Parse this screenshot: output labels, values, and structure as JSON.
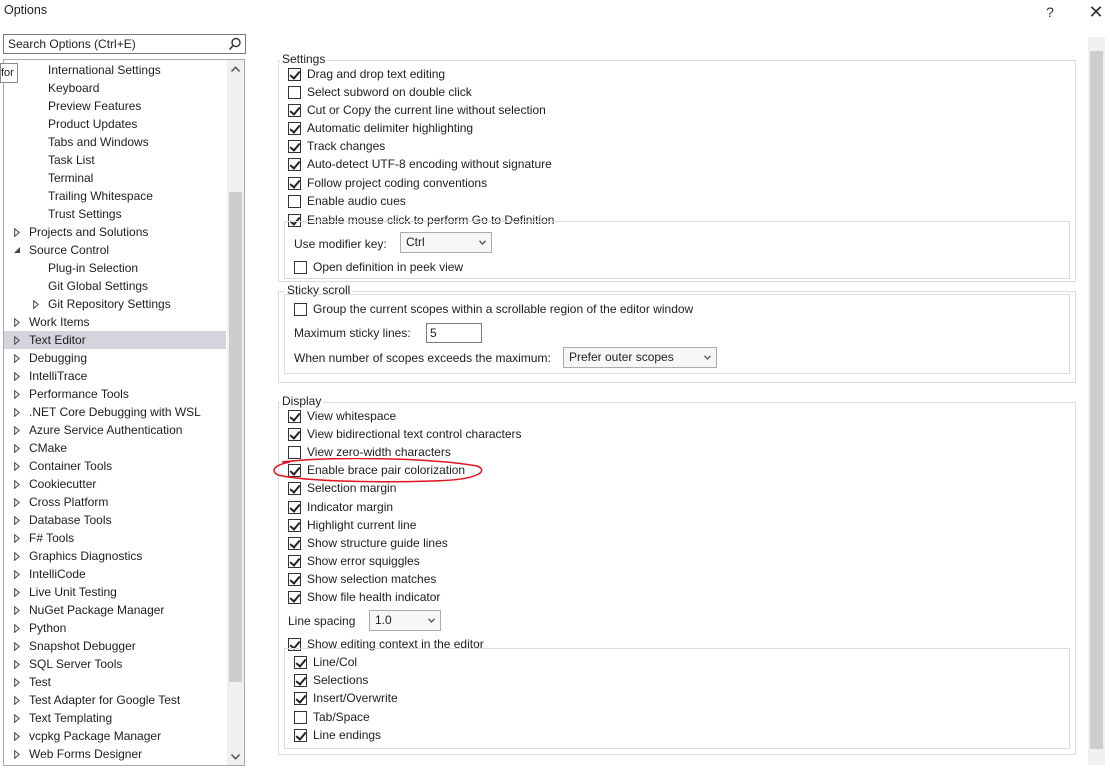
{
  "window": {
    "title": "Options",
    "help_glyph": "?",
    "close_glyph": "✕"
  },
  "search": {
    "placeholder": "Search Options (Ctrl+E)"
  },
  "tooltip_fragment": "for",
  "tree": {
    "items": [
      {
        "label": "International Settings",
        "indent": 2,
        "expander": ""
      },
      {
        "label": "Keyboard",
        "indent": 2,
        "expander": ""
      },
      {
        "label": "Preview Features",
        "indent": 2,
        "expander": ""
      },
      {
        "label": "Product Updates",
        "indent": 2,
        "expander": ""
      },
      {
        "label": "Tabs and Windows",
        "indent": 2,
        "expander": ""
      },
      {
        "label": "Task List",
        "indent": 2,
        "expander": ""
      },
      {
        "label": "Terminal",
        "indent": 2,
        "expander": ""
      },
      {
        "label": "Trailing Whitespace",
        "indent": 2,
        "expander": ""
      },
      {
        "label": "Trust Settings",
        "indent": 2,
        "expander": ""
      },
      {
        "label": "Projects and Solutions",
        "indent": 1,
        "expander": "collapsed"
      },
      {
        "label": "Source Control",
        "indent": 1,
        "expander": "expanded"
      },
      {
        "label": "Plug-in Selection",
        "indent": 2,
        "expander": ""
      },
      {
        "label": "Git Global Settings",
        "indent": 2,
        "expander": ""
      },
      {
        "label": "Git Repository Settings",
        "indent": 2,
        "expander": "collapsed"
      },
      {
        "label": "Work Items",
        "indent": 1,
        "expander": "collapsed"
      },
      {
        "label": "Text Editor",
        "indent": 1,
        "expander": "collapsed",
        "selected": true
      },
      {
        "label": "Debugging",
        "indent": 1,
        "expander": "collapsed"
      },
      {
        "label": "IntelliTrace",
        "indent": 1,
        "expander": "collapsed"
      },
      {
        "label": "Performance Tools",
        "indent": 1,
        "expander": "collapsed"
      },
      {
        "label": ".NET Core Debugging with WSL",
        "indent": 1,
        "expander": "collapsed"
      },
      {
        "label": "Azure Service Authentication",
        "indent": 1,
        "expander": "collapsed"
      },
      {
        "label": "CMake",
        "indent": 1,
        "expander": "collapsed"
      },
      {
        "label": "Container Tools",
        "indent": 1,
        "expander": "collapsed"
      },
      {
        "label": "Cookiecutter",
        "indent": 1,
        "expander": "collapsed"
      },
      {
        "label": "Cross Platform",
        "indent": 1,
        "expander": "collapsed"
      },
      {
        "label": "Database Tools",
        "indent": 1,
        "expander": "collapsed"
      },
      {
        "label": "F# Tools",
        "indent": 1,
        "expander": "collapsed"
      },
      {
        "label": "Graphics Diagnostics",
        "indent": 1,
        "expander": "collapsed"
      },
      {
        "label": "IntelliCode",
        "indent": 1,
        "expander": "collapsed"
      },
      {
        "label": "Live Unit Testing",
        "indent": 1,
        "expander": "collapsed"
      },
      {
        "label": "NuGet Package Manager",
        "indent": 1,
        "expander": "collapsed"
      },
      {
        "label": "Python",
        "indent": 1,
        "expander": "collapsed"
      },
      {
        "label": "Snapshot Debugger",
        "indent": 1,
        "expander": "collapsed"
      },
      {
        "label": "SQL Server Tools",
        "indent": 1,
        "expander": "collapsed"
      },
      {
        "label": "Test",
        "indent": 1,
        "expander": "collapsed"
      },
      {
        "label": "Test Adapter for Google Test",
        "indent": 1,
        "expander": "collapsed"
      },
      {
        "label": "Text Templating",
        "indent": 1,
        "expander": "collapsed"
      },
      {
        "label": "vcpkg Package Manager",
        "indent": 1,
        "expander": "collapsed"
      },
      {
        "label": "Web Forms Designer",
        "indent": 1,
        "expander": "collapsed"
      }
    ]
  },
  "settings": {
    "title": "Settings",
    "options": [
      {
        "label": "Drag and drop text editing",
        "checked": true
      },
      {
        "label": "Select subword on double click",
        "checked": false
      },
      {
        "label": "Cut or Copy the current line without selection",
        "checked": true
      },
      {
        "label": "Automatic delimiter highlighting",
        "checked": true
      },
      {
        "label": "Track changes",
        "checked": true
      },
      {
        "label": "Auto-detect UTF-8 encoding without signature",
        "checked": true
      },
      {
        "label": "Follow project coding conventions",
        "checked": true
      },
      {
        "label": "Enable audio cues",
        "checked": false
      },
      {
        "label": "Enable mouse click to perform Go to Definition",
        "checked": true
      }
    ],
    "modifier_key_label": "Use modifier key:",
    "modifier_key_value": "Ctrl",
    "peek_label": "Open definition in peek view",
    "peek_checked": false
  },
  "sticky_scroll": {
    "title": "Sticky scroll",
    "group_label": "Group the current scopes within a scrollable region of the editor window",
    "group_checked": false,
    "max_lines_label": "Maximum sticky lines:",
    "max_lines_value": "5",
    "exceeds_label": "When number of scopes exceeds the maximum:",
    "exceeds_value": "Prefer outer scopes"
  },
  "display": {
    "title": "Display",
    "options": [
      {
        "label": "View whitespace",
        "checked": true
      },
      {
        "label": "View bidirectional text control characters",
        "checked": true
      },
      {
        "label": "View zero-width characters",
        "checked": false
      },
      {
        "label": "Enable brace pair colorization",
        "checked": true
      },
      {
        "label": "Selection margin",
        "checked": true
      },
      {
        "label": "Indicator margin",
        "checked": true
      },
      {
        "label": "Highlight current line",
        "checked": true
      },
      {
        "label": "Show structure guide lines",
        "checked": true
      },
      {
        "label": "Show error squiggles",
        "checked": true
      },
      {
        "label": "Show selection matches",
        "checked": true
      },
      {
        "label": "Show file health indicator",
        "checked": true
      }
    ],
    "line_spacing_label": "Line spacing",
    "line_spacing_value": "1.0",
    "editing_context_label": "Show editing context in the editor",
    "editing_context_checked": true,
    "editing_context_options": [
      {
        "label": "Line/Col",
        "checked": true
      },
      {
        "label": "Selections",
        "checked": true
      },
      {
        "label": "Insert/Overwrite",
        "checked": true
      },
      {
        "label": "Tab/Space",
        "checked": false
      },
      {
        "label": "Line endings",
        "checked": true
      }
    ]
  },
  "colors": {
    "selection_bg": "#cce0f5",
    "annotation": "#e0141e"
  }
}
